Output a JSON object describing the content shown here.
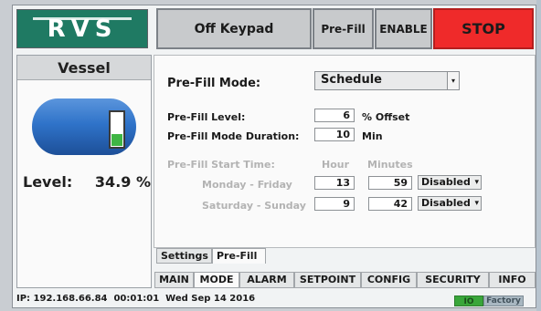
{
  "header": {
    "logo_text": "RVS",
    "off_keypad_label": "Off Keypad",
    "prefill_label": "Pre-Fill",
    "enable_label": "ENABLE",
    "stop_label": "STOP",
    "stop_color": "#ef2a2a"
  },
  "vessel": {
    "title": "Vessel",
    "level_label": "Level:",
    "level_value": "34.9 %",
    "level_fraction": 0.349,
    "tank_color": "#2f73c9",
    "gauge_color": "#3fb544"
  },
  "form": {
    "mode_label": "Pre-Fill Mode:",
    "mode_value": "Schedule",
    "level_label": "Pre-Fill Level:",
    "level_value": "6",
    "level_unit": "% Offset",
    "duration_label": "Pre-Fill Mode Duration:",
    "duration_value": "10",
    "duration_unit": "Min",
    "start_time_label": "Pre-Fill Start Time:",
    "hour_header": "Hour",
    "minutes_header": "Minutes",
    "schedules": [
      {
        "day": "Monday - Friday",
        "hour": "13",
        "minutes": "59",
        "status": "Disabled"
      },
      {
        "day": "Saturday - Sunday",
        "hour": "9",
        "minutes": "42",
        "status": "Disabled"
      }
    ]
  },
  "subtabs": [
    "Settings",
    "Pre-Fill"
  ],
  "tabs": [
    "MAIN",
    "MODE",
    "ALARM",
    "SETPOINT",
    "CONFIG",
    "SECURITY",
    "INFO"
  ],
  "status_bar": {
    "text": "IP: 192.168.66.84  00:01:01  Wed Sep 14 2016",
    "io_label": "IO",
    "factory_label": "Factory",
    "io_color": "#39a63a"
  }
}
